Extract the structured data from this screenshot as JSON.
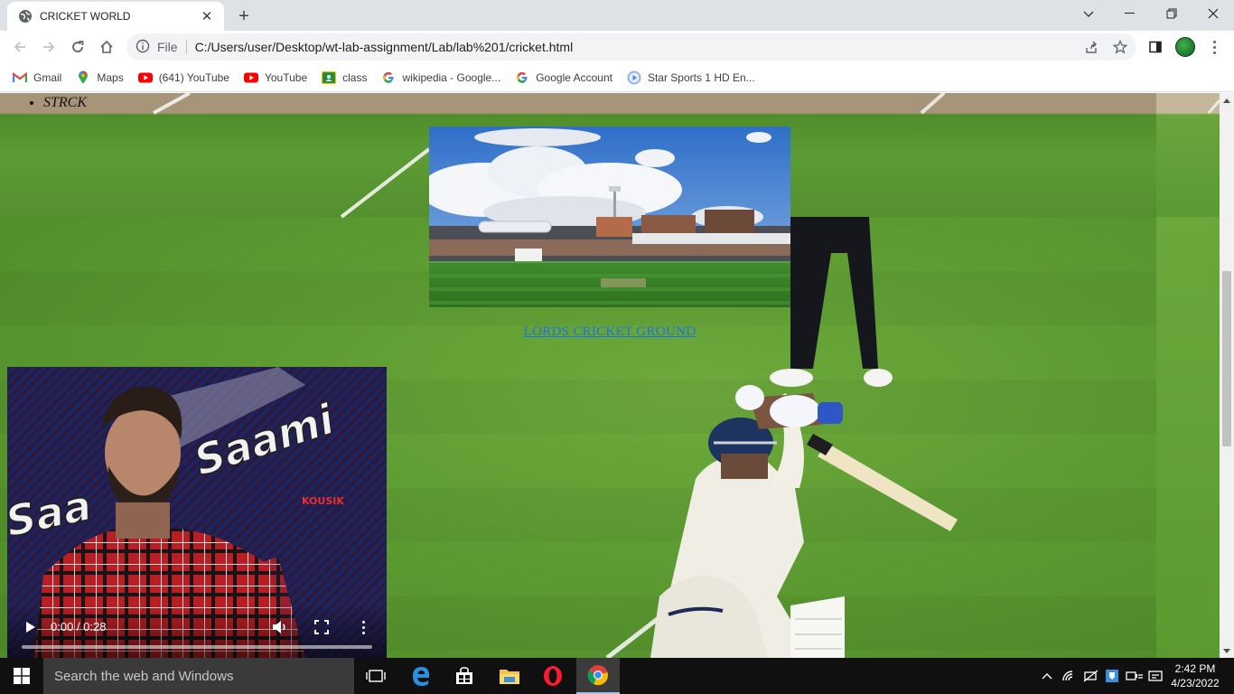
{
  "browser": {
    "tab_title": "CRICKET WORLD",
    "tab_close": "✕",
    "new_tab": "+",
    "address_scheme": "File",
    "address_url": "C:/Users/user/Desktop/wt-lab-assignment/Lab/lab%201/cricket.html"
  },
  "bookmarks": [
    {
      "label": "Gmail",
      "icon": "gmail-icon"
    },
    {
      "label": "Maps",
      "icon": "maps-icon"
    },
    {
      "label": "(641) YouTube",
      "icon": "youtube-icon"
    },
    {
      "label": "YouTube",
      "icon": "youtube-icon"
    },
    {
      "label": "class",
      "icon": "classroom-icon"
    },
    {
      "label": "wikipedia - Google...",
      "icon": "google-icon"
    },
    {
      "label": "Google Account",
      "icon": "google-icon"
    },
    {
      "label": "Star Sports 1 HD En...",
      "icon": "play-icon"
    }
  ],
  "page": {
    "list_items": [
      "STRCK"
    ],
    "ground_link": "LORDS CRICKET GROUND"
  },
  "video": {
    "time": "0:00 / 0:28",
    "progress": 0,
    "overlay_text_1": "Saami",
    "overlay_text_2": "Saa",
    "overlay_tag": "KOUSIK"
  },
  "taskbar": {
    "search_placeholder": "Search the web and Windows",
    "time": "2:42 PM",
    "date": "4/23/2022"
  },
  "colors": {
    "link": "#1a73e8",
    "grass": "#5d9c32",
    "taskbar": "#101010"
  }
}
